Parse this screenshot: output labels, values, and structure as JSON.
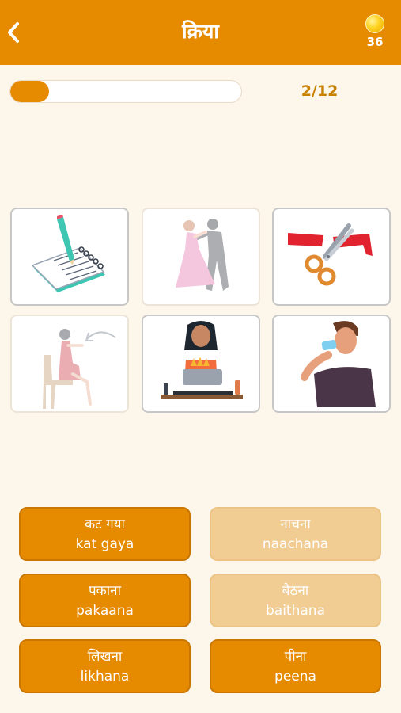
{
  "header": {
    "back_icon": "chevron-left-icon",
    "title": "क्रिया",
    "coin_icon": "coin-icon",
    "coin_count": "36"
  },
  "progress": {
    "current": 2,
    "total": 12,
    "fraction": 0.167,
    "label": "2/12"
  },
  "image_cards": [
    {
      "icon": "writing-notebook-icon",
      "state": "active"
    },
    {
      "icon": "dancing-couple-icon",
      "state": "faded"
    },
    {
      "icon": "scissors-ribbon-icon",
      "state": "active"
    },
    {
      "icon": "sitting-woman-icon",
      "state": "faded"
    },
    {
      "icon": "cooking-woman-icon",
      "state": "active"
    },
    {
      "icon": "drinking-man-icon",
      "state": "active"
    }
  ],
  "answers": [
    {
      "hindi": "कट गया",
      "translit": "kat gaya",
      "state": "active"
    },
    {
      "hindi": "नाचना",
      "translit": "naachana",
      "state": "used"
    },
    {
      "hindi": "पकाना",
      "translit": "pakaana",
      "state": "active"
    },
    {
      "hindi": "बैठना",
      "translit": "baithana",
      "state": "used"
    },
    {
      "hindi": "लिखना",
      "translit": "likhana",
      "state": "active"
    },
    {
      "hindi": "पीना",
      "translit": "peena",
      "state": "active"
    }
  ],
  "colors": {
    "accent": "#e68a00",
    "background": "#fdf6ea",
    "used_answer": "#f2cd93",
    "progress_text": "#c98100"
  }
}
